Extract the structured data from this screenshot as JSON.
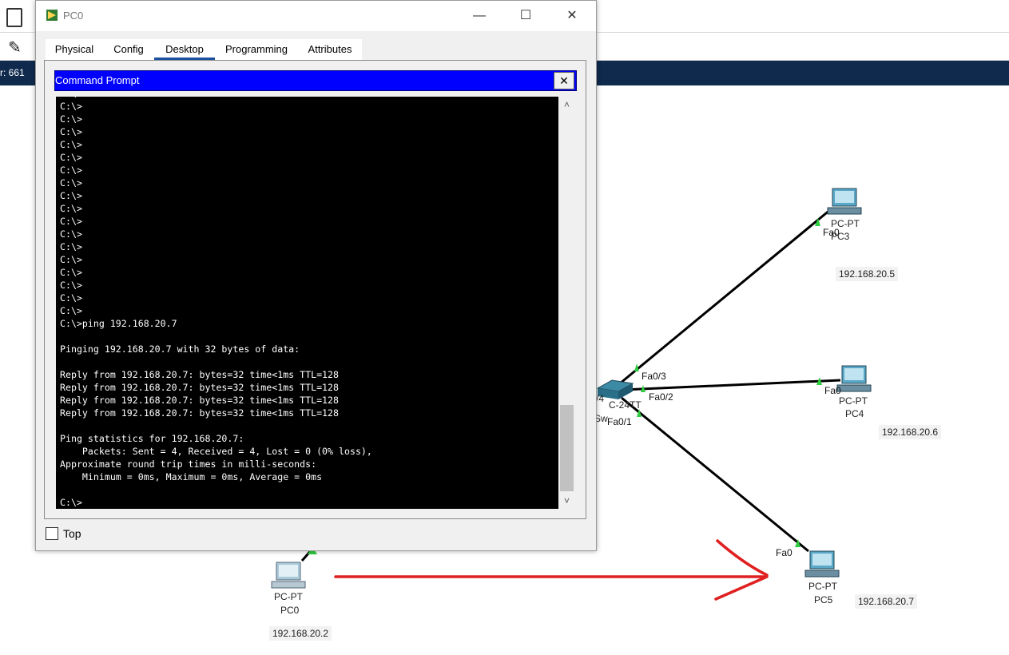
{
  "workspace": {
    "nav_left_text": "r: 661",
    "switch": {
      "label_line1": "/4",
      "label_line2": "Sw",
      "model_fragment": "C-24TT",
      "ports": [
        "Fa0/3",
        "Fa0/2",
        "Fa0/1"
      ]
    },
    "pcs": [
      {
        "id": "PC3",
        "type_label": "PC-PT",
        "name": "PC3",
        "port": "Fa0",
        "ip": "192.168.20.5"
      },
      {
        "id": "PC4",
        "type_label": "PC-PT",
        "name": "PC4",
        "port": "Fa0",
        "ip": "192.168.20.6"
      },
      {
        "id": "PC5",
        "type_label": "PC-PT",
        "name": "PC5",
        "port": "Fa0",
        "ip": "192.168.20.7"
      },
      {
        "id": "PC0",
        "type_label": "PC-PT",
        "name": "PC0",
        "ip": "192.168.20.2"
      }
    ],
    "annotation_color": "#e02020",
    "link_color": "#000000",
    "link_up_color": "#2ecc40"
  },
  "window": {
    "title": "PC0",
    "controls": {
      "minimize": "—",
      "maximize": "☐",
      "close": "✕"
    },
    "tabs": [
      "Physical",
      "Config",
      "Desktop",
      "Programming",
      "Attributes"
    ],
    "active_tab": "Desktop",
    "command_prompt": {
      "title": "Command Prompt",
      "close_glyph": "✕",
      "terminal_text": "C:\\>\nC:\\>\nC:\\>\nC:\\>\nC:\\>\nC:\\>\nC:\\>\nC:\\>\nC:\\>\nC:\\>\nC:\\>\nC:\\>\nC:\\>\nC:\\>\nC:\\>\nC:\\>\nC:\\>\nC:\\>\nC:\\>ping 192.168.20.7\n\nPinging 192.168.20.7 with 32 bytes of data:\n\nReply from 192.168.20.7: bytes=32 time<1ms TTL=128\nReply from 192.168.20.7: bytes=32 time<1ms TTL=128\nReply from 192.168.20.7: bytes=32 time<1ms TTL=128\nReply from 192.168.20.7: bytes=32 time<1ms TTL=128\n\nPing statistics for 192.168.20.7:\n    Packets: Sent = 4, Received = 4, Lost = 0 (0% loss),\nApproximate round trip times in milli-seconds:\n    Minimum = 0ms, Maximum = 0ms, Average = 0ms\n\nC:\\>"
    },
    "top_checkbox": {
      "label": "Top",
      "checked": false
    }
  }
}
